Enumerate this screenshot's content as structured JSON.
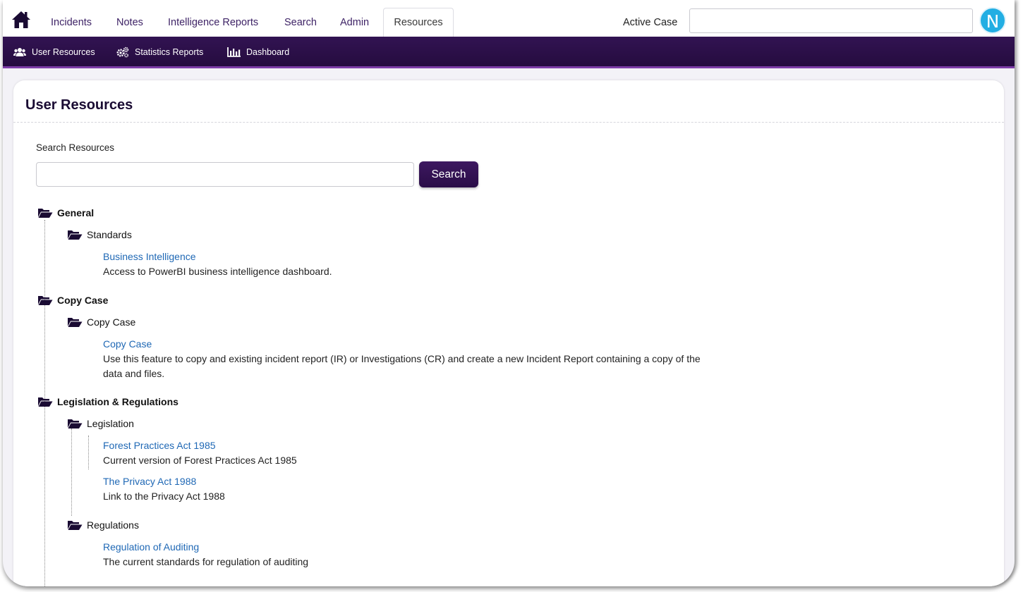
{
  "topnav": {
    "tabs": [
      {
        "label": "Incidents"
      },
      {
        "label": "Notes"
      },
      {
        "label": "Intelligence Reports"
      },
      {
        "label": "Search"
      },
      {
        "label": "Admin"
      },
      {
        "label": "Resources",
        "active": true
      }
    ],
    "active_case_label": "Active Case",
    "active_case_value": "",
    "avatar_letter": "N"
  },
  "subnav": {
    "items": [
      {
        "label": "User Resources",
        "icon": "users-icon"
      },
      {
        "label": "Statistics Reports",
        "icon": "gears-icon"
      },
      {
        "label": "Dashboard",
        "icon": "bar-chart-icon"
      }
    ]
  },
  "page": {
    "title": "User Resources",
    "search_label": "Search Resources",
    "search_value": "",
    "search_button": "Search"
  },
  "tree": [
    {
      "category": "General",
      "subfolders": [
        {
          "name": "Standards",
          "items": [
            {
              "link": "Business Intelligence",
              "desc": "Access to PowerBI business intelligence dashboard."
            }
          ]
        }
      ]
    },
    {
      "category": "Copy Case",
      "subfolders": [
        {
          "name": "Copy Case",
          "items": [
            {
              "link": "Copy Case",
              "desc": "Use this feature to copy and existing incident report (IR) or Investigations (CR) and create a new Incident Report containing a copy of the data and files."
            }
          ]
        }
      ]
    },
    {
      "category": "Legislation & Regulations",
      "subfolders": [
        {
          "name": "Legislation",
          "items": [
            {
              "link": "Forest Practices Act 1985",
              "desc": "Current version of Forest Practices Act 1985"
            },
            {
              "link": "The Privacy Act 1988",
              "desc": "Link to the Privacy Act 1988"
            }
          ]
        },
        {
          "name": "Regulations",
          "items": [
            {
              "link": "Regulation of Auditing",
              "desc": "The current standards for regulation of auditing"
            }
          ]
        }
      ]
    }
  ],
  "colors": {
    "brand": "#2a0d47",
    "link": "#1f68b5",
    "accent": "#22aee3"
  }
}
